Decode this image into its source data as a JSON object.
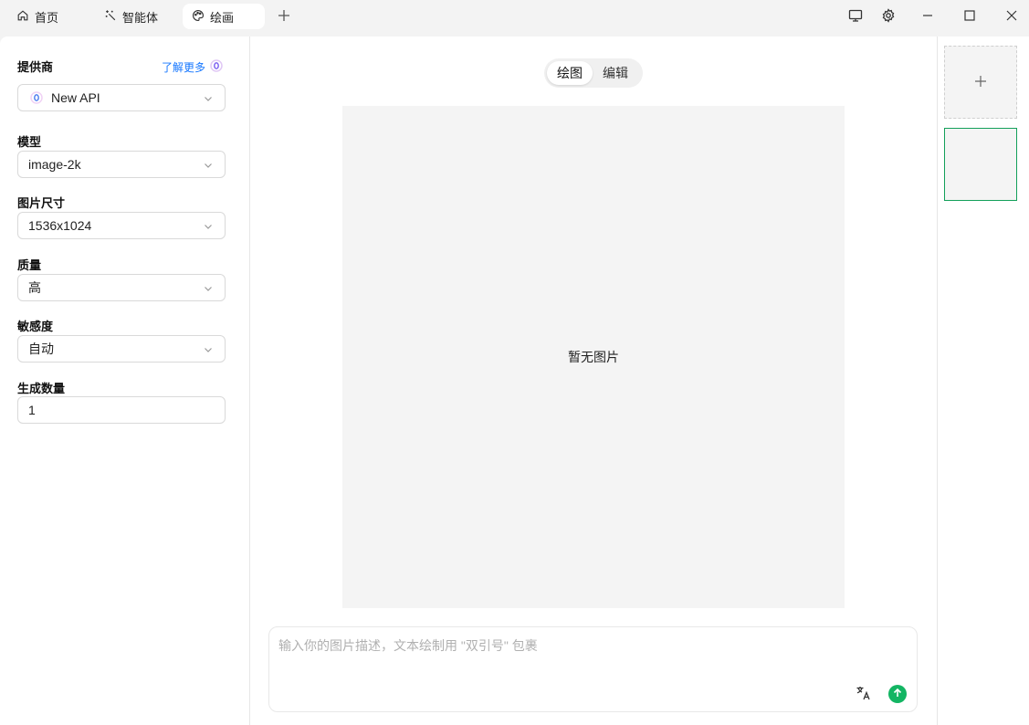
{
  "tabs": [
    {
      "label": "首页",
      "icon": "home-icon"
    },
    {
      "label": "智能体",
      "icon": "sparkle-wand-icon"
    },
    {
      "label": "绘画",
      "icon": "palette-icon",
      "active": true
    }
  ],
  "sidebar": {
    "provider": {
      "label": "提供商",
      "learn_more": "了解更多",
      "value": "New API"
    },
    "model": {
      "label": "模型",
      "value": "image-2k"
    },
    "size": {
      "label": "图片尺寸",
      "value": "1536x1024"
    },
    "quality": {
      "label": "质量",
      "value": "高"
    },
    "moderation": {
      "label": "敏感度",
      "value": "自动"
    },
    "count": {
      "label": "生成数量",
      "value": "1"
    }
  },
  "main": {
    "modes": [
      "绘图",
      "编辑"
    ],
    "active_mode": "绘图",
    "empty_text": "暂无图片",
    "prompt_placeholder": "输入你的图片描述，文本绘制用 \"双引号\" 包裹"
  },
  "colors": {
    "accent_green": "#13b563",
    "link_blue": "#1677ff"
  }
}
